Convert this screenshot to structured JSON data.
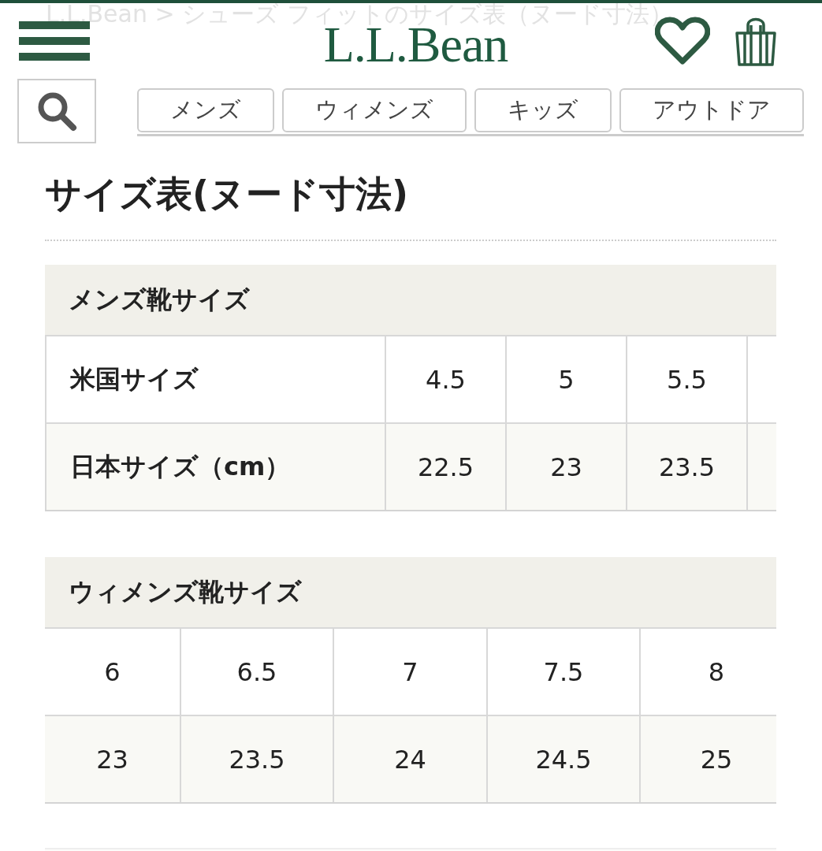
{
  "breadcrumb": "L.L.Bean > シューズ フィットのサイズ表（ヌード寸法）",
  "header": {
    "logo": "L.L.Bean"
  },
  "category_tabs": [
    {
      "label": "メンズ"
    },
    {
      "label": "ウィメンズ"
    },
    {
      "label": "キッズ"
    },
    {
      "label": "アウトドア"
    }
  ],
  "page_title": "サイズ表(ヌード寸法)",
  "size_tables": [
    {
      "title": "メンズ靴サイズ",
      "kind": "labeled",
      "rows": [
        {
          "label": "米国サイズ",
          "values": [
            "4.5",
            "5",
            "5.5"
          ]
        },
        {
          "label": "日本サイズ（cm）",
          "values": [
            "22.5",
            "23",
            "23.5"
          ]
        }
      ]
    },
    {
      "title": "ウィメンズ靴サイズ",
      "kind": "plain",
      "rows": [
        {
          "values": [
            "6",
            "6.5",
            "7",
            "7.5",
            "8"
          ]
        },
        {
          "values": [
            "23",
            "23.5",
            "24",
            "24.5",
            "25"
          ]
        }
      ]
    }
  ]
}
